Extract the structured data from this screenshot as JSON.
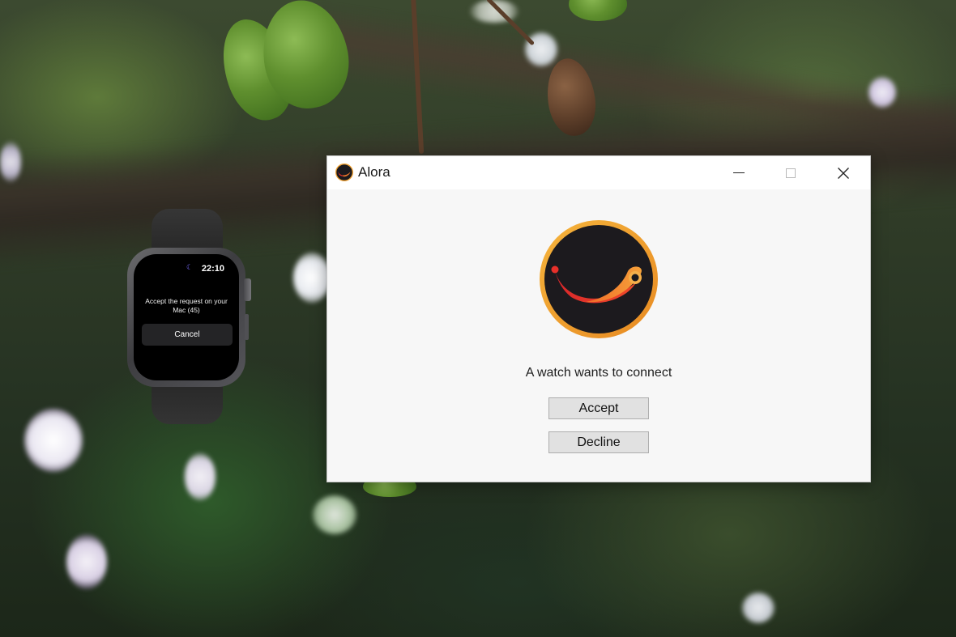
{
  "watch": {
    "time": "22:10",
    "message": "Accept the request on your Mac (45)",
    "cancel_label": "Cancel",
    "status_icon": "moon-icon"
  },
  "window": {
    "title": "Alora",
    "app_icon": "alora-logo-icon",
    "controls": [
      "minimize-icon",
      "maximize-icon",
      "close-icon"
    ],
    "prompt": "A watch wants to connect",
    "accept_label": "Accept",
    "decline_label": "Decline"
  },
  "colors": {
    "logo_ring": "#f0a030",
    "logo_fill": "#1c1a1e",
    "logo_swoosh_red": "#e8302a",
    "logo_swoosh_orange": "#f07a2a",
    "window_bg": "#f7f7f7",
    "button_bg": "#e1e1e1"
  }
}
